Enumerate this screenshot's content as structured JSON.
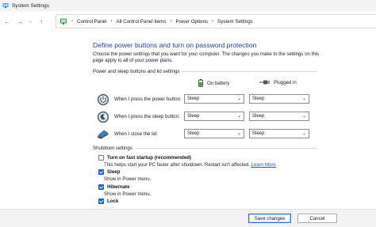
{
  "window": {
    "title": "System Settings"
  },
  "nav": {
    "back": "←",
    "forward": "→",
    "recent": "⌄",
    "up": "↑",
    "breadcrumbs": [
      "Control Panel",
      "All Control Panel Items",
      "Power Options",
      "System Settings"
    ],
    "separator": "›"
  },
  "page": {
    "title": "Define power buttons and turn on password protection",
    "description": "Choose the power settings that you want for your computer. The changes you make to the settings on this page apply to all of your power plans."
  },
  "power_section": {
    "header": "Power and sleep buttons and lid settings",
    "columns": [
      "On battery",
      "Plugged in"
    ],
    "rows": [
      {
        "label": "When I press the power button:",
        "icon": "power-button-icon",
        "battery": "Sleep",
        "plugged": "Sleep"
      },
      {
        "label": "When I press the sleep button:",
        "icon": "sleep-button-icon",
        "battery": "Sleep",
        "plugged": "Sleep"
      },
      {
        "label": "When I close the lid:",
        "icon": "laptop-lid-icon",
        "battery": "Sleep",
        "plugged": "Sleep"
      }
    ]
  },
  "shutdown_section": {
    "header": "Shutdown settings",
    "options": [
      {
        "label": "Turn on fast startup (recommended)",
        "checked": false,
        "desc": "This helps start your PC faster after shutdown. Restart isn't affected.",
        "link": "Learn More"
      },
      {
        "label": "Sleep",
        "checked": true,
        "desc": "Show in Power menu."
      },
      {
        "label": "Hibernate",
        "checked": true,
        "desc": "Show in Power menu."
      },
      {
        "label": "Lock",
        "checked": true,
        "desc": ""
      }
    ]
  },
  "footer": {
    "save": "Save changes",
    "cancel": "Cancel"
  },
  "colors": {
    "title_blue": "#1f3e9a",
    "link_blue": "#1a5fc7",
    "checkbox_blue": "#1a63c7"
  }
}
